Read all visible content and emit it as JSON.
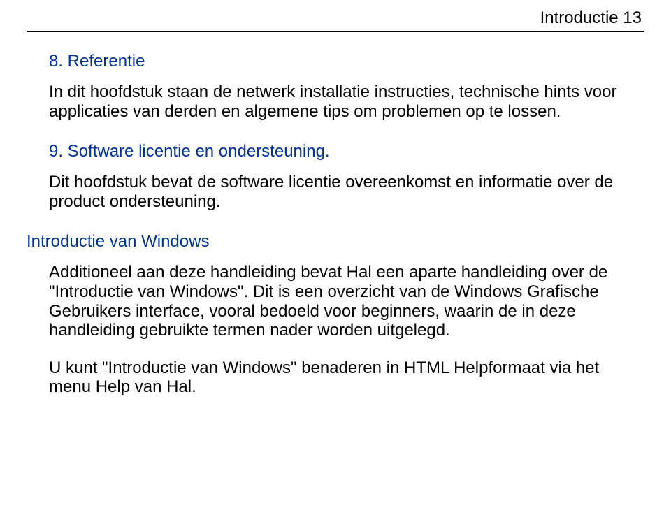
{
  "header": {
    "label": "Introductie  13"
  },
  "section1": {
    "heading": "8. Referentie",
    "body": "In dit hoofdstuk staan de netwerk installatie instructies, technische hints voor applicaties van derden en algemene tips om problemen op te lossen."
  },
  "section2": {
    "heading": "9. Software licentie en ondersteuning.",
    "body": "Dit hoofdstuk bevat de software licentie overeenkomst en informatie over de product ondersteuning."
  },
  "section3": {
    "heading": "Introductie van Windows",
    "body1": "Additioneel aan deze handleiding bevat Hal een aparte handleiding over de \"Introductie van Windows\". Dit is een overzicht van de Windows Grafische Gebruikers interface, vooral bedoeld voor beginners, waarin de in deze handleiding gebruikte termen nader worden uitgelegd.",
    "body2": "U kunt \"Introductie van Windows\" benaderen in HTML Helpformaat via het menu Help van Hal."
  }
}
